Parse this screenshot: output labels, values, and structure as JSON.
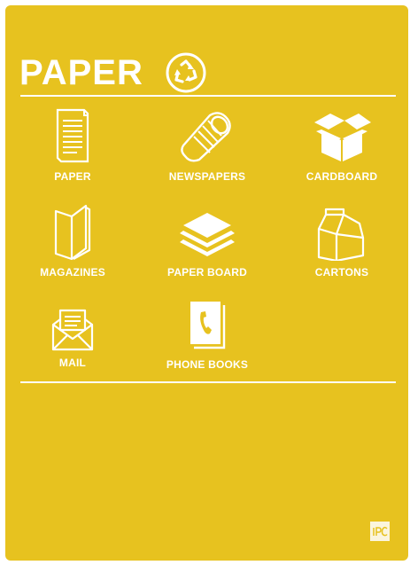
{
  "sign": {
    "title": "PAPER",
    "background_color": "#e7c21f",
    "foreground_color": "#ffffff",
    "title_icon": "recycle-icon",
    "logo_text": "IPC"
  },
  "items": [
    {
      "label": "PAPER",
      "icon": "paper-sheet-icon"
    },
    {
      "label": "NEWSPAPERS",
      "icon": "rolled-newspaper-icon"
    },
    {
      "label": "CARDBOARD",
      "icon": "cardboard-box-icon"
    },
    {
      "label": "MAGAZINES",
      "icon": "magazine-icon"
    },
    {
      "label": "PAPER BOARD",
      "icon": "stacked-board-icon"
    },
    {
      "label": "CARTONS",
      "icon": "milk-carton-icon"
    },
    {
      "label": "MAIL",
      "icon": "envelope-letter-icon"
    },
    {
      "label": "PHONE BOOKS",
      "icon": "phone-book-icon"
    }
  ]
}
